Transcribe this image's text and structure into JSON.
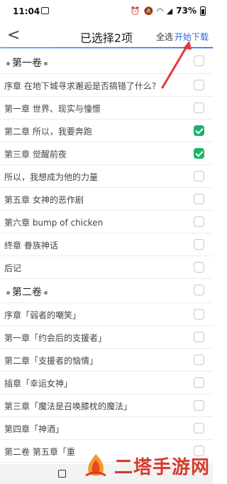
{
  "status": {
    "time": "11:04",
    "battery": "73%"
  },
  "header": {
    "title": "已选择2项",
    "select_all": "全选",
    "start_download": "开始下载"
  },
  "rows": [
    {
      "type": "volume",
      "label": "第一卷",
      "checked": false
    },
    {
      "type": "chapter",
      "label": "序章 在地下城寻求邂逅是否搞错了什么?",
      "checked": false
    },
    {
      "type": "chapter",
      "label": "第一章 世界、现实与憧憬",
      "checked": false
    },
    {
      "type": "chapter",
      "label": "第二章 所以，我要奔跑",
      "checked": true
    },
    {
      "type": "chapter",
      "label": "第三章 觉醒前夜",
      "checked": true
    },
    {
      "type": "chapter",
      "label": "所以，我想成为他的力量",
      "checked": false
    },
    {
      "type": "chapter",
      "label": "第五章 女神的恶作剧",
      "checked": false
    },
    {
      "type": "chapter",
      "label": "第六章 bump of chicken",
      "checked": false
    },
    {
      "type": "chapter",
      "label": "终章 眷族神话",
      "checked": false
    },
    {
      "type": "chapter",
      "label": "后记",
      "checked": false
    },
    {
      "type": "volume",
      "label": "第二卷",
      "checked": false
    },
    {
      "type": "chapter",
      "label": "序章「弱者的嘲笑」",
      "checked": false
    },
    {
      "type": "chapter",
      "label": "第一章「约会后的支援者」",
      "checked": false
    },
    {
      "type": "chapter",
      "label": "第二章「支援者的恼情」",
      "checked": false
    },
    {
      "type": "chapter",
      "label": "插章「幸运女神」",
      "checked": false
    },
    {
      "type": "chapter",
      "label": "第三章「魔法是召唤膝枕的魔法」",
      "checked": false
    },
    {
      "type": "chapter",
      "label": "第四章「神酒」",
      "checked": false
    },
    {
      "type": "chapter",
      "label": "第二卷 第五章「重",
      "checked": false
    }
  ],
  "watermark": {
    "text": "二塔手游网"
  },
  "colors": {
    "accent": "#2e6bd8",
    "check": "#19b56a",
    "arrow": "#e53935",
    "watermark": "#d63b2c"
  }
}
